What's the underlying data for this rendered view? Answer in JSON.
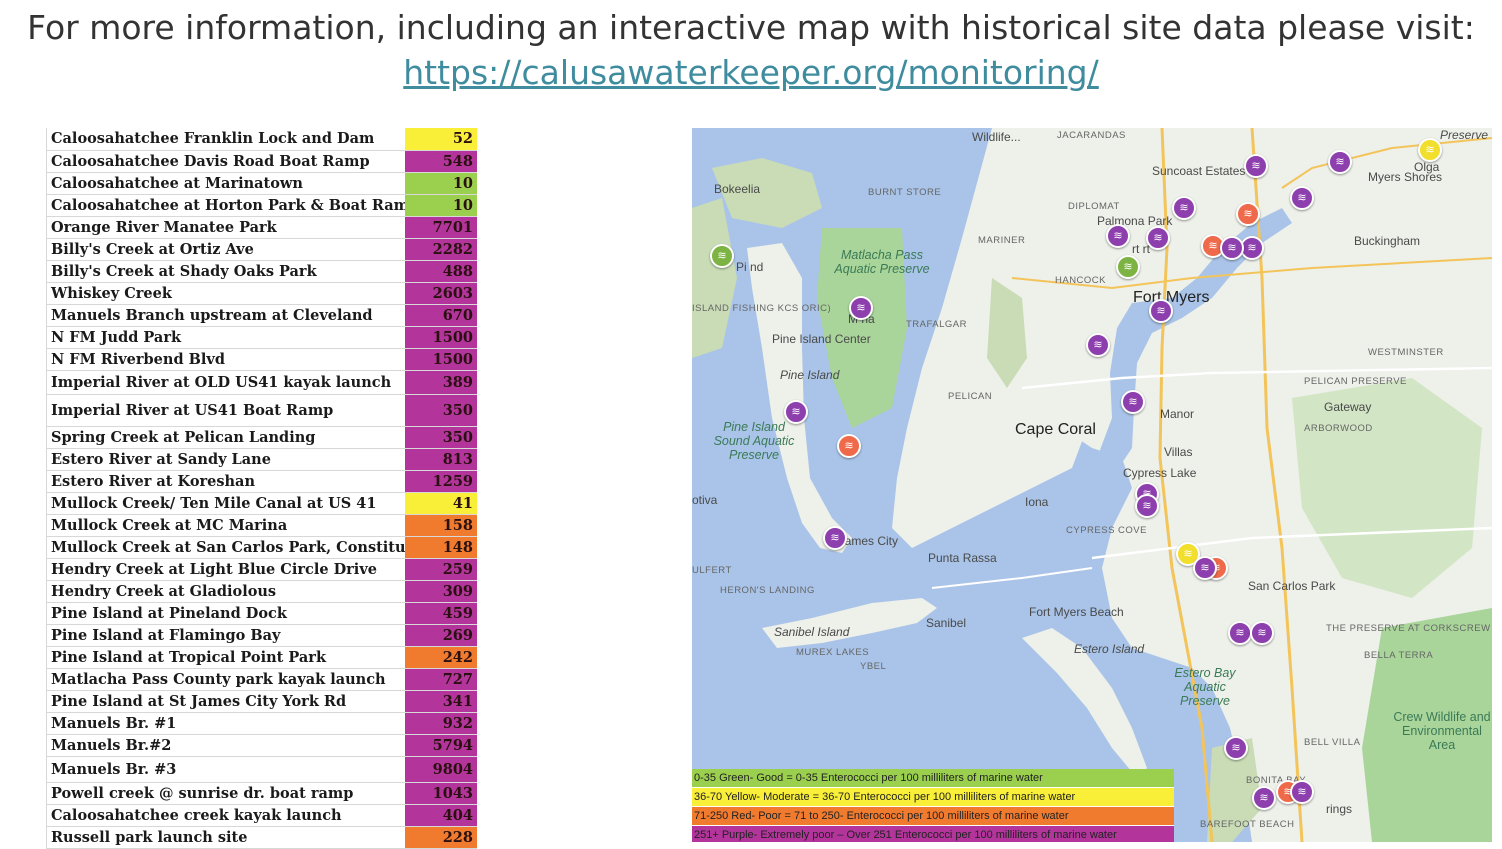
{
  "header": {
    "info_text": "For more information, including an interactive map with historical site data please visit:",
    "link_text": "https://calusawaterkeeper.org/monitoring/"
  },
  "colors": {
    "green": "#9bd04e",
    "yellow": "#f9ef38",
    "red": "#f07b2e",
    "purple": "#b3349b",
    "marker_green": "#7cb342",
    "marker_yellow": "#f2de2c",
    "marker_red": "#ef6a4a",
    "marker_purple": "#8e3fae"
  },
  "sites": [
    {
      "name": "Caloosahatchee Franklin Lock and Dam",
      "value": "52",
      "category": "yellow"
    },
    {
      "name": "Caloosahatchee Davis Road Boat Ramp",
      "value": "548",
      "category": "purple"
    },
    {
      "name": "Caloosahatchee at Marinatown",
      "value": "10",
      "category": "green"
    },
    {
      "name": "Caloosahatchee at Horton Park & Boat Ramp",
      "value": "10",
      "category": "green"
    },
    {
      "name": "Orange River Manatee Park",
      "value": "7701",
      "category": "purple"
    },
    {
      "name": "Billy's Creek at Ortiz Ave",
      "value": "2282",
      "category": "purple"
    },
    {
      "name": "Billy's Creek at Shady Oaks Park",
      "value": "488",
      "category": "purple"
    },
    {
      "name": "Whiskey Creek",
      "value": "2603",
      "category": "purple"
    },
    {
      "name": "Manuels Branch upstream at Cleveland",
      "value": "670",
      "category": "purple"
    },
    {
      "name": "N FM Judd Park",
      "value": "1500",
      "category": "purple"
    },
    {
      "name": "N FM Riverbend Blvd",
      "value": "1500",
      "category": "purple"
    },
    {
      "name": "Imperial River at OLD US41 kayak launch",
      "value": "389",
      "category": "purple"
    },
    {
      "name": "Imperial River at US41 Boat Ramp",
      "value": "350",
      "category": "purple"
    },
    {
      "name": "Spring Creek at Pelican Landing",
      "value": "350",
      "category": "purple"
    },
    {
      "name": "Estero River at Sandy Lane",
      "value": "813",
      "category": "purple"
    },
    {
      "name": "Estero River at Koreshan",
      "value": "1259",
      "category": "purple"
    },
    {
      "name": "Mullock Creek/ Ten Mile Canal at US 41",
      "value": "41",
      "category": "yellow"
    },
    {
      "name": "Mullock Creek at MC Marina",
      "value": "158",
      "category": "red"
    },
    {
      "name": "Mullock Creek at San Carlos Park, Constitutio",
      "value": "148",
      "category": "red"
    },
    {
      "name": "Hendry Creek at Light Blue Circle Drive",
      "value": "259",
      "category": "purple"
    },
    {
      "name": "Hendry Creek at Gladiolous",
      "value": "309",
      "category": "purple"
    },
    {
      "name": "Pine Island at Pineland Dock",
      "value": "459",
      "category": "purple"
    },
    {
      "name": "Pine Island at Flamingo Bay",
      "value": "269",
      "category": "purple"
    },
    {
      "name": "Pine Island at Tropical Point Park",
      "value": "242",
      "category": "red"
    },
    {
      "name": "Matlacha Pass County park kayak launch",
      "value": "727",
      "category": "purple"
    },
    {
      "name": "Pine Island at St James City York Rd",
      "value": "341",
      "category": "purple"
    },
    {
      "name": "Manuels Br. #1",
      "value": "932",
      "category": "purple"
    },
    {
      "name": "Manuels Br.#2",
      "value": "5794",
      "category": "purple"
    },
    {
      "name": "Manuels Br. #3",
      "value": "9804",
      "category": "purple"
    },
    {
      "name": "Powell creek @ sunrise dr. boat ramp",
      "value": "1043",
      "category": "purple"
    },
    {
      "name": "Caloosahatchee creek kayak launch",
      "value": "404",
      "category": "purple"
    },
    {
      "name": "Russell park launch site",
      "value": "228",
      "category": "red"
    }
  ],
  "map": {
    "places": {
      "wildlife": "Wildlife...",
      "jacarandas": "JACARANDAS",
      "preserve_tr": "Preserve",
      "suncoast_estates": "Suncoast Estates",
      "olga": "Olga",
      "myers_shores": "Myers Shores",
      "bokeelia": "Bokeelia",
      "burnt_store": "BURNT STORE",
      "diplomat": "DIPLOMAT",
      "palmona_park": "Palmona Park",
      "mariner": "MARINER",
      "buckingham": "Buckingham",
      "matlacha_pass": "Matlacha Pass Aquatic Preserve",
      "hancock": "HANCOCK",
      "fort_myers": "Fort Myers",
      "island_fishing": "ISLAND FISHING KCS ORIC)",
      "trafalgar": "TRAFALGAR",
      "pine_island_center": "Pine Island Center",
      "westminster": "WESTMINSTER",
      "pine_island": "Pine Island",
      "pelican": "PELICAN",
      "pelican_preserve": "PELICAN PRESERVE",
      "gateway": "Gateway",
      "manor": "Manor",
      "arborwood": "ARBORWOOD",
      "pine_island_sound": "Pine Island Sound Aquatic Preserve",
      "cape_coral": "Cape Coral",
      "villas": "Villas",
      "cypress_lake": "Cypress Lake",
      "iona": "Iona",
      "cypress_cove": "CYPRESS COVE",
      "otiva": "otiva",
      "st_james_city": "St James City",
      "punta_rassa": "Punta Rassa",
      "culfert": "ULFERT",
      "herons_landing": "HERON'S LANDING",
      "san_carlos_park": "San Carlos Park",
      "the_preserve_corkscrew": "THE PRESERVE AT CORKSCREW",
      "fort_myers_beach": "Fort Myers Beach",
      "sanibel": "Sanibel",
      "sanibel_island": "Sanibel Island",
      "murex_lakes": "MUREX LAKES",
      "ybel": "YBEL",
      "estero_island": "Estero Island",
      "bella_terra": "BELLA TERRA",
      "estero_bay": "Estero Bay Aquatic Preserve",
      "crew_wildlife": "Crew Wildlife and Environmental Area",
      "bell_villa": "BELL VILLA",
      "bonita_bay": "BONITA BAY",
      "barefoot_beach": "BAREFOOT BEACH",
      "springs": "rings",
      "pineland": "Pi     nd",
      "matlacha": "M        ha",
      "fort_myers_partial": "rt      rt"
    },
    "markers": [
      {
        "color": "purple"
      },
      {
        "color": "purple"
      },
      {
        "color": "yellow"
      },
      {
        "color": "purple"
      },
      {
        "color": "purple"
      },
      {
        "color": "red"
      },
      {
        "color": "purple"
      },
      {
        "color": "red"
      },
      {
        "color": "purple"
      },
      {
        "color": "purple"
      },
      {
        "color": "purple"
      },
      {
        "color": "purple"
      },
      {
        "color": "green"
      },
      {
        "color": "purple"
      },
      {
        "color": "purple"
      },
      {
        "color": "purple"
      },
      {
        "color": "green"
      },
      {
        "color": "purple"
      },
      {
        "color": "purple"
      },
      {
        "color": "purple"
      },
      {
        "color": "red"
      },
      {
        "color": "purple"
      },
      {
        "color": "yellow"
      },
      {
        "color": "red"
      },
      {
        "color": "purple"
      },
      {
        "color": "purple"
      },
      {
        "color": "purple"
      },
      {
        "color": "purple"
      },
      {
        "color": "purple"
      },
      {
        "color": "red"
      },
      {
        "color": "purple"
      }
    ],
    "legend": [
      {
        "text": "0-35   Green- Good = 0-35 Enterococci per 100 milliliters of marine water",
        "color": "green"
      },
      {
        "text": "36-70    Yellow- Moderate = 36-70 Enterococci per 100 milliliters of marine water",
        "color": "yellow"
      },
      {
        "text": "71-250    Red- Poor = 71 to 250-  Enterococci per 100 milliliters of marine water",
        "color": "red"
      },
      {
        "text": "251+   Purple- Extremely poor – Over 251 Enterococci per 100 milliliters of marine water",
        "color": "purple"
      }
    ]
  }
}
